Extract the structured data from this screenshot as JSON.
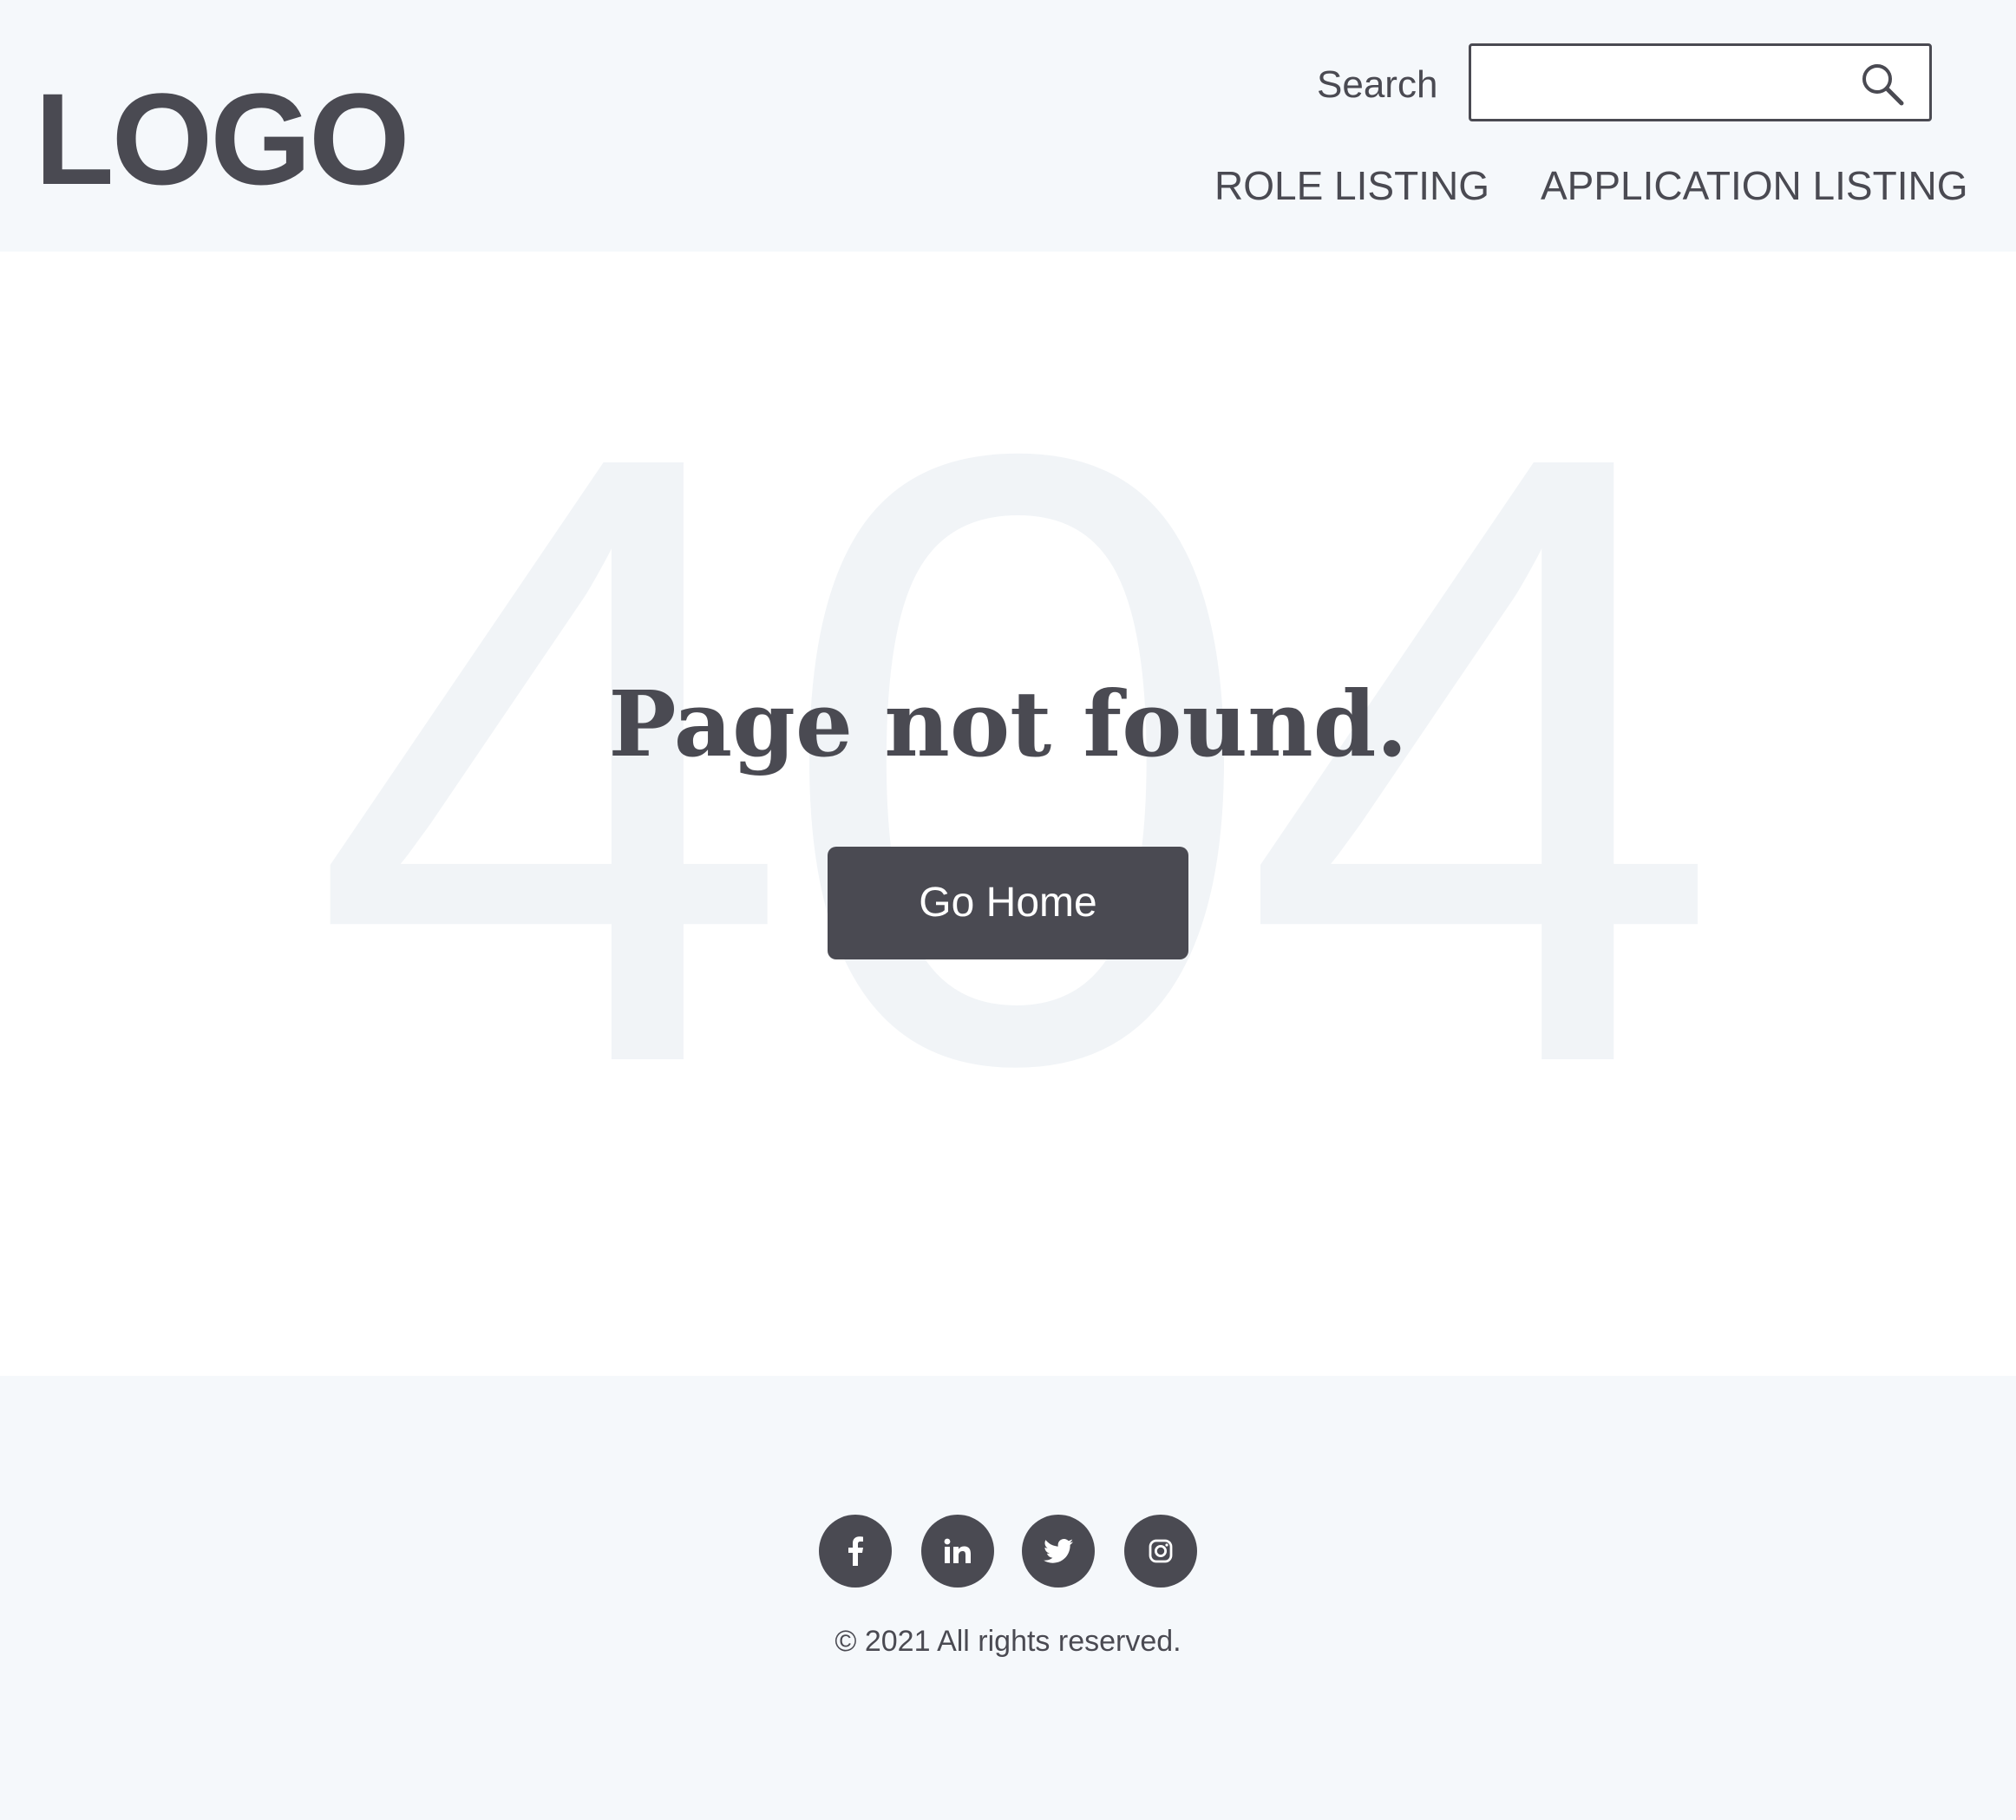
{
  "header": {
    "logo_text": "LOGO",
    "search_label": "Search",
    "search_placeholder": "",
    "search_value": "",
    "nav": {
      "role_listing": "ROLE LISTING",
      "application_listing": "APPLICATION LISTING"
    }
  },
  "main": {
    "background_code": "404",
    "title": "Page not found.",
    "go_home_label": "Go Home"
  },
  "footer": {
    "social": [
      {
        "icon": "facebook-icon"
      },
      {
        "icon": "linkedin-icon"
      },
      {
        "icon": "twitter-icon"
      },
      {
        "icon": "instagram-icon"
      }
    ],
    "copyright": "© 2021 All rights reserved."
  },
  "colors": {
    "primary_dark": "#4a4a52",
    "header_footer_bg": "#f5f8fb",
    "background_code": "#f1f4f7",
    "page_bg": "#ffffff"
  }
}
